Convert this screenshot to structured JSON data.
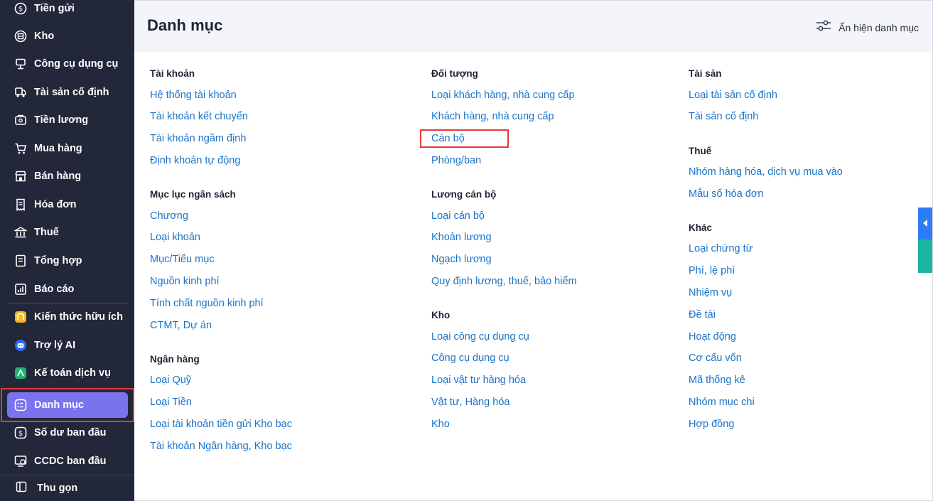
{
  "sidebar": {
    "items": [
      {
        "label": "Tiền gửi",
        "icon": "coin-icon"
      },
      {
        "label": "Kho",
        "icon": "warehouse-icon"
      },
      {
        "label": "Công cụ dụng cụ",
        "icon": "tools-icon"
      },
      {
        "label": "Tài sản cố định",
        "icon": "truck-icon"
      },
      {
        "label": "Tiền lương",
        "icon": "wallet-icon"
      },
      {
        "label": "Mua hàng",
        "icon": "cart-icon"
      },
      {
        "label": "Bán hàng",
        "icon": "store-icon"
      },
      {
        "label": "Hóa đơn",
        "icon": "receipt-icon"
      },
      {
        "label": "Thuế",
        "icon": "bank-icon"
      },
      {
        "label": "Tổng hợp",
        "icon": "document-icon"
      },
      {
        "label": "Báo cáo",
        "icon": "chart-icon"
      },
      {
        "label": "Kiến thức hữu ích",
        "icon": "knowledge-icon"
      },
      {
        "label": "Trợ lý AI",
        "icon": "ai-assistant-icon"
      },
      {
        "label": "Kế toán dịch vụ",
        "icon": "service-icon"
      },
      {
        "label": "Danh mục",
        "icon": "list-icon",
        "active": true
      },
      {
        "label": "Số dư ban đầu",
        "icon": "balance-icon"
      },
      {
        "label": "CCDC ban đầu",
        "icon": "ccdc-icon"
      }
    ],
    "collapse_label": "Thu gọn"
  },
  "header": {
    "title": "Danh mục",
    "toggle_label": "Ẩn hiện danh mục"
  },
  "columns": [
    {
      "groups": [
        {
          "title": "Tài khoản",
          "links": [
            "Hệ thống tài khoản",
            "Tài khoản kết chuyển",
            "Tài khoản ngầm định",
            "Định khoản tự động"
          ]
        },
        {
          "title": "Mục lục ngân sách",
          "links": [
            "Chương",
            "Loại khoản",
            "Mục/Tiểu mục",
            "Nguồn kinh phí",
            "Tính chất nguồn kinh phí",
            "CTMT, Dự án"
          ]
        },
        {
          "title": "Ngân hàng",
          "links": [
            "Loại Quỹ",
            "Loại Tiền",
            "Loại tài khoản tiền gửi Kho bạc",
            "Tài khoản Ngân hàng, Kho bạc"
          ]
        }
      ]
    },
    {
      "groups": [
        {
          "title": "Đối tượng",
          "links": [
            "Loại khách hàng, nhà cung cấp",
            "Khách hàng, nhà cung cấp",
            "Cán bộ",
            "Phòng/ban"
          ]
        },
        {
          "title": "Lương cán bộ",
          "links": [
            "Loại cán bộ",
            "Khoản lương",
            "Ngạch lương",
            "Quy định lương, thuế, bảo hiểm"
          ]
        },
        {
          "title": "Kho",
          "links": [
            "Loại công cụ dụng cụ",
            "Công cụ dụng cụ",
            "Loại vật tư hàng hóa",
            "Vật tư, Hàng hóa",
            "Kho"
          ]
        }
      ]
    },
    {
      "groups": [
        {
          "title": "Tài sản",
          "links": [
            "Loại tài sản cố định",
            "Tài sản cố định"
          ]
        },
        {
          "title": "Thuế",
          "links": [
            "Nhóm hàng hóa, dịch vụ mua vào",
            "Mẫu số hóa đơn"
          ]
        },
        {
          "title": "Khác",
          "links": [
            "Loại chứng từ",
            "Phí, lệ phí",
            "Nhiệm vụ",
            "Đề tài",
            "Hoạt động",
            "Cơ cấu vốn",
            "Mã thống kê",
            "Nhóm mục chi",
            "Hợp đồng"
          ]
        }
      ]
    }
  ],
  "colors": {
    "sidebar_bg": "#23273a",
    "active_item": "#7a73f0",
    "link": "#1a73c7",
    "highlight_border": "#e53935",
    "side_tab_blue": "#2e7df6",
    "side_tab_teal": "#1cb5a4"
  }
}
